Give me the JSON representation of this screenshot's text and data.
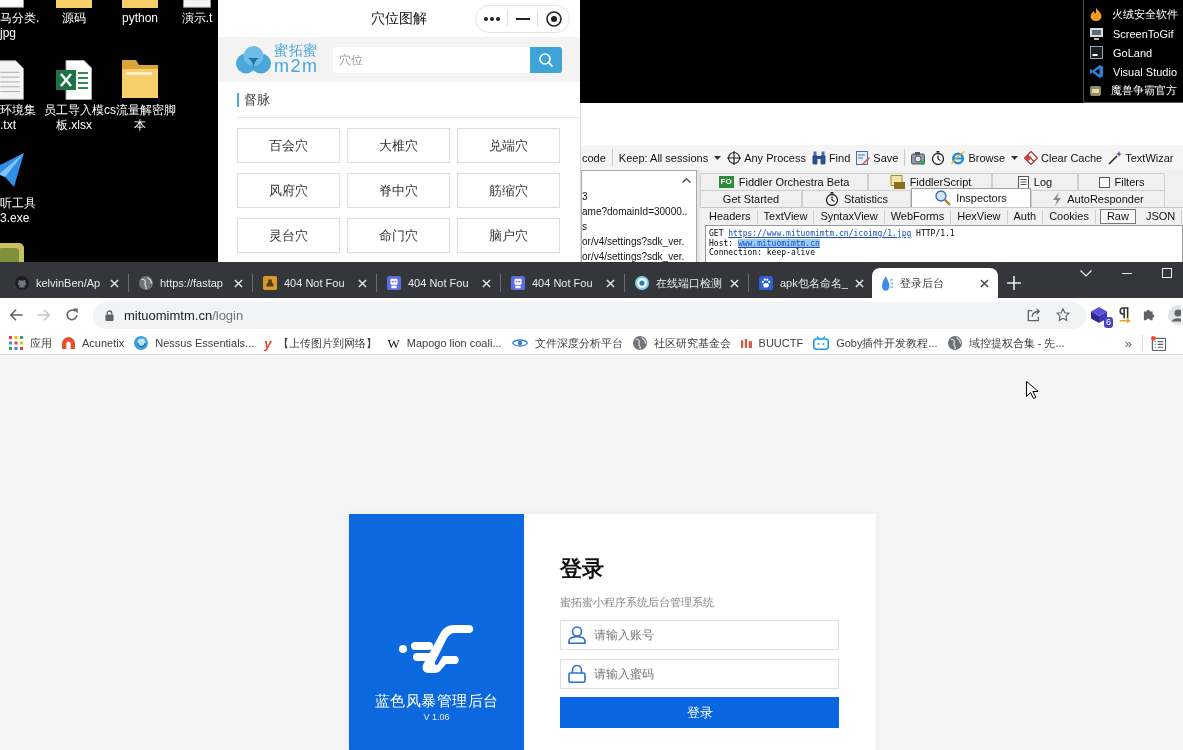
{
  "desktop": {
    "icon_rows": [
      [
        {
          "kind": "image",
          "lines": [
            "马分类.",
            "jpg"
          ]
        },
        {
          "kind": "folder",
          "lines": [
            "源码"
          ]
        },
        {
          "kind": "folder",
          "lines": [
            "python"
          ]
        },
        {
          "kind": "text",
          "lines": [
            "演示.t"
          ]
        }
      ],
      [
        {
          "kind": "text",
          "lines": [
            "环境集",
            ".txt"
          ]
        },
        {
          "kind": "excel",
          "lines": [
            "员工导入模",
            "板.xlsx"
          ]
        },
        {
          "kind": "folder",
          "lines": [
            "cs流量解密脚",
            "本"
          ]
        }
      ],
      [
        {
          "kind": "plane",
          "lines": [
            "听工具",
            "3.exe"
          ]
        }
      ],
      [
        {
          "kind": "app"
        }
      ]
    ],
    "app_list": [
      {
        "kind": "flame",
        "label": "火绒安全软件"
      },
      {
        "kind": "monitor",
        "label": "ScreenToGif"
      },
      {
        "kind": "tile",
        "label": "GoLand"
      },
      {
        "kind": "ribbon",
        "label": "Visual Studio"
      },
      {
        "kind": "app",
        "label": "魔兽争霸官方"
      }
    ]
  },
  "mini_program": {
    "title": "穴位图解",
    "logo": {
      "name": "蜜拓蜜",
      "short": "m2m"
    },
    "search": {
      "placeholder": "穴位"
    },
    "section": "督脉",
    "points": [
      "百会穴",
      "大椎穴",
      "兑端穴",
      "风府穴",
      "脊中穴",
      "筋缩穴",
      "灵台穴",
      "命门穴",
      "脑户穴"
    ]
  },
  "fiddler": {
    "toolbar": [
      {
        "kind": "cut",
        "label": "code"
      },
      {
        "kind": "separator"
      },
      {
        "kind": "dropdown",
        "label": "Keep: All sessions"
      },
      {
        "kind": "process",
        "label": "Any Process"
      },
      {
        "kind": "find",
        "label": "Find"
      },
      {
        "kind": "save",
        "label": "Save"
      },
      {
        "kind": "separator"
      },
      {
        "kind": "camera"
      },
      {
        "kind": "timer"
      },
      {
        "kind": "browse",
        "label": "Browse"
      },
      {
        "kind": "clear",
        "label": "Clear Cache"
      },
      {
        "kind": "wizard",
        "label": "TextWizar"
      }
    ],
    "sessions": [
      "3",
      "ame?domainId=30000..",
      "s",
      "or/v4/settings?sdk_ver.",
      "or/v4/settings?sdk_ver."
    ],
    "tabs_row_1": [
      {
        "kind": "orchestra",
        "icon_text": "FO",
        "label": "Fiddler Orchestra Beta",
        "selected": false
      },
      {
        "kind": "script",
        "label": "FiddlerScript",
        "selected": false
      },
      {
        "kind": "log",
        "label": "Log",
        "selected": false
      },
      {
        "kind": "filters",
        "label": "Filters",
        "checked": false,
        "selected": false
      }
    ],
    "tabs_row_2": [
      {
        "kind": "plain",
        "label": "Get Started",
        "selected": false
      },
      {
        "kind": "statistics",
        "label": "Statistics",
        "selected": false
      },
      {
        "kind": "inspectors",
        "label": "Inspectors",
        "selected": true
      },
      {
        "kind": "autoresponder",
        "label": "AutoResponder",
        "selected": false
      }
    ],
    "inspector_tabs": [
      {
        "label": "Headers",
        "selected": false
      },
      {
        "label": "TextView",
        "selected": false
      },
      {
        "label": "SyntaxView",
        "selected": false
      },
      {
        "label": "WebForms",
        "selected": false
      },
      {
        "label": "HexView",
        "selected": false
      },
      {
        "label": "Auth",
        "selected": false
      },
      {
        "label": "Cookies",
        "selected": false
      },
      {
        "label": "Raw",
        "selected": true
      },
      {
        "label": "JSON",
        "selected": false
      }
    ],
    "request_lines": [
      {
        "parts": [
          {
            "kind": "plain",
            "text": "GET "
          },
          {
            "kind": "link",
            "text": "https://www.mituomimtm.cn/icoimg/1.jpg",
            "selected": false
          },
          {
            "kind": "plain",
            "text": " HTTP/1.1"
          }
        ]
      },
      {
        "parts": [
          {
            "kind": "plain",
            "text": "Host: "
          },
          {
            "kind": "link",
            "text": "www.mituomimtm.cn",
            "selected": true
          }
        ]
      },
      {
        "parts": [
          {
            "kind": "plain",
            "text": "Connection: keep-alive"
          }
        ]
      }
    ]
  },
  "browser": {
    "tabs": [
      {
        "kind": "github",
        "title": "kelvinBen/Ap",
        "selected": false
      },
      {
        "kind": "globe",
        "title": "https://fastap",
        "selected": false
      },
      {
        "kind": "tile_a",
        "title": "404 Not Fou",
        "selected": false
      },
      {
        "kind": "tile_b",
        "title": "404 Not Fou",
        "selected": false
      },
      {
        "kind": "tile_b",
        "title": "404 Not Fou",
        "selected": false
      },
      {
        "kind": "pj",
        "title": "在线端口检测",
        "selected": false
      },
      {
        "kind": "paw",
        "title": "apk包名命名_",
        "selected": false
      },
      {
        "kind": "drop",
        "title": "登录后台",
        "selected": true
      }
    ],
    "nav": [
      {
        "kind": "back",
        "disabled": false
      },
      {
        "kind": "forward",
        "disabled": true
      },
      {
        "kind": "reload",
        "disabled": false
      }
    ],
    "address": {
      "host": "mituomimtm.cn",
      "path": "/login"
    },
    "extensions": [
      {
        "kind": "cube",
        "badge": "6"
      },
      {
        "kind": "pilcrow"
      },
      {
        "kind": "puzzle"
      },
      {
        "kind": "profile"
      }
    ],
    "bookmarks": [
      {
        "kind": "apps",
        "label": "应用"
      },
      {
        "kind": "acunetix",
        "label": "Acunetix"
      },
      {
        "kind": "nessus",
        "label": "Nessus Essentials..."
      },
      {
        "kind": "red_letter",
        "icon_text": "y",
        "label": "【上传图片到网络】"
      },
      {
        "kind": "serif_letter",
        "icon_text": "W",
        "label": "Mapogo lion coali..."
      },
      {
        "kind": "eye",
        "label": "文件深度分析平台"
      },
      {
        "kind": "globe",
        "label": "社区研究基金会"
      },
      {
        "kind": "bars",
        "label": "BUUCTF"
      },
      {
        "kind": "tv",
        "label": "Goby插件开发教程..."
      },
      {
        "kind": "globe",
        "label": "域控提权合集 - 先..."
      }
    ],
    "bookmarks_overflow": "»"
  },
  "login": {
    "brand": "蓝色风暴管理后台",
    "version": "V 1.06",
    "title": "登录",
    "subtitle": "蜜拓蜜小程序系统后台管理系统",
    "fields": [
      {
        "kind": "user",
        "placeholder": "请输入账号"
      },
      {
        "kind": "lock",
        "placeholder": "请输入蜜码"
      }
    ],
    "button": "登录"
  }
}
